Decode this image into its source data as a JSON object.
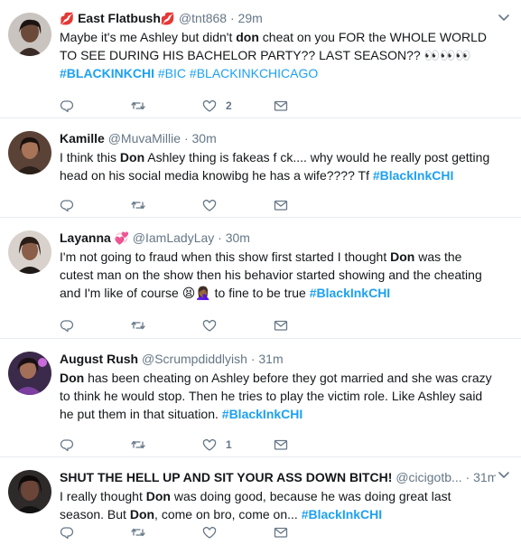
{
  "tweets": [
    {
      "name": "East Flatbush",
      "name_suffix_emoji": "💋",
      "name_prefix_emoji": "💋",
      "handle": "@tnt868",
      "separator": "·",
      "time": "29m",
      "text": [
        {
          "t": "Maybe it's me Ashley but didn't "
        },
        {
          "t": "don",
          "b": true
        },
        {
          "t": " cheat on you FOR the WHOLE WORLD TO SEE DURING HIS BACHELOR PARTY?? LAST SEASON?? 👀👀👀 "
        },
        {
          "t": "#BLACKINKCHI",
          "tag": true
        },
        {
          "t": " "
        },
        {
          "t": "#BIC",
          "tagplain": true
        },
        {
          "t": " "
        },
        {
          "t": "#BLACKINKCHICAGO",
          "tagplain": true
        }
      ],
      "replies": "",
      "retweets": "",
      "likes": "2"
    },
    {
      "name": "Kamille",
      "handle": "@MuvaMillie",
      "separator": "·",
      "time": "30m",
      "text": [
        {
          "t": "I think this "
        },
        {
          "t": "Don",
          "b": true
        },
        {
          "t": " Ashley thing is fakeas f ck.... why would he really post getting head on his social media knowibg he has a wife???? Tf "
        },
        {
          "t": "#BlackInkCHI",
          "tag": true
        }
      ],
      "replies": "",
      "retweets": "",
      "likes": ""
    },
    {
      "name": "Layanna",
      "name_suffix_emoji": "💞",
      "handle": "@IamLadyLay",
      "separator": "·",
      "time": "30m",
      "text": [
        {
          "t": "I'm not going to fraud when this show first started I thought "
        },
        {
          "t": "Don",
          "b": true
        },
        {
          "t": " was the cutest man on the show then his behavior started showing and the cheating and I'm like of course 😫🤦🏾‍♀️ to fine to be true "
        },
        {
          "t": "#BlackInkCHI",
          "tag": true
        }
      ],
      "replies": "",
      "retweets": "",
      "likes": ""
    },
    {
      "name": "August Rush",
      "handle": "@Scrumpdiddlyish",
      "separator": "·",
      "time": "31m",
      "text": [
        {
          "t": "Don",
          "b": true
        },
        {
          "t": " has been cheating on Ashley before they got married and she was crazy to think he would stop. Then he tries to play the victim role. Like Ashley said he put them in that situation. "
        },
        {
          "t": "#BlackInkCHI",
          "tag": true
        }
      ],
      "replies": "",
      "retweets": "",
      "likes": "1"
    },
    {
      "name": "SHUT THE HELL UP AND SIT YOUR ASS DOWN BITCH!",
      "handle": "@cicigotb...",
      "separator": "·",
      "time": "31m",
      "text": [
        {
          "t": "I really thought "
        },
        {
          "t": "Don",
          "b": true
        },
        {
          "t": " was doing good, because he was doing great last season. But "
        },
        {
          "t": "Don",
          "b": true
        },
        {
          "t": ", come on bro, come on... "
        },
        {
          "t": "#BlackInkCHI",
          "tag": true
        }
      ],
      "replies": "",
      "retweets": "",
      "likes": ""
    }
  ],
  "icons": {
    "reply": "reply-icon",
    "retweet": "retweet-icon",
    "like": "heart-icon",
    "dm": "envelope-icon",
    "caret": "chevron-down-icon"
  },
  "colors": {
    "link": "#1da1f2",
    "secondary": "#657786",
    "divider": "#e6ecf0"
  }
}
